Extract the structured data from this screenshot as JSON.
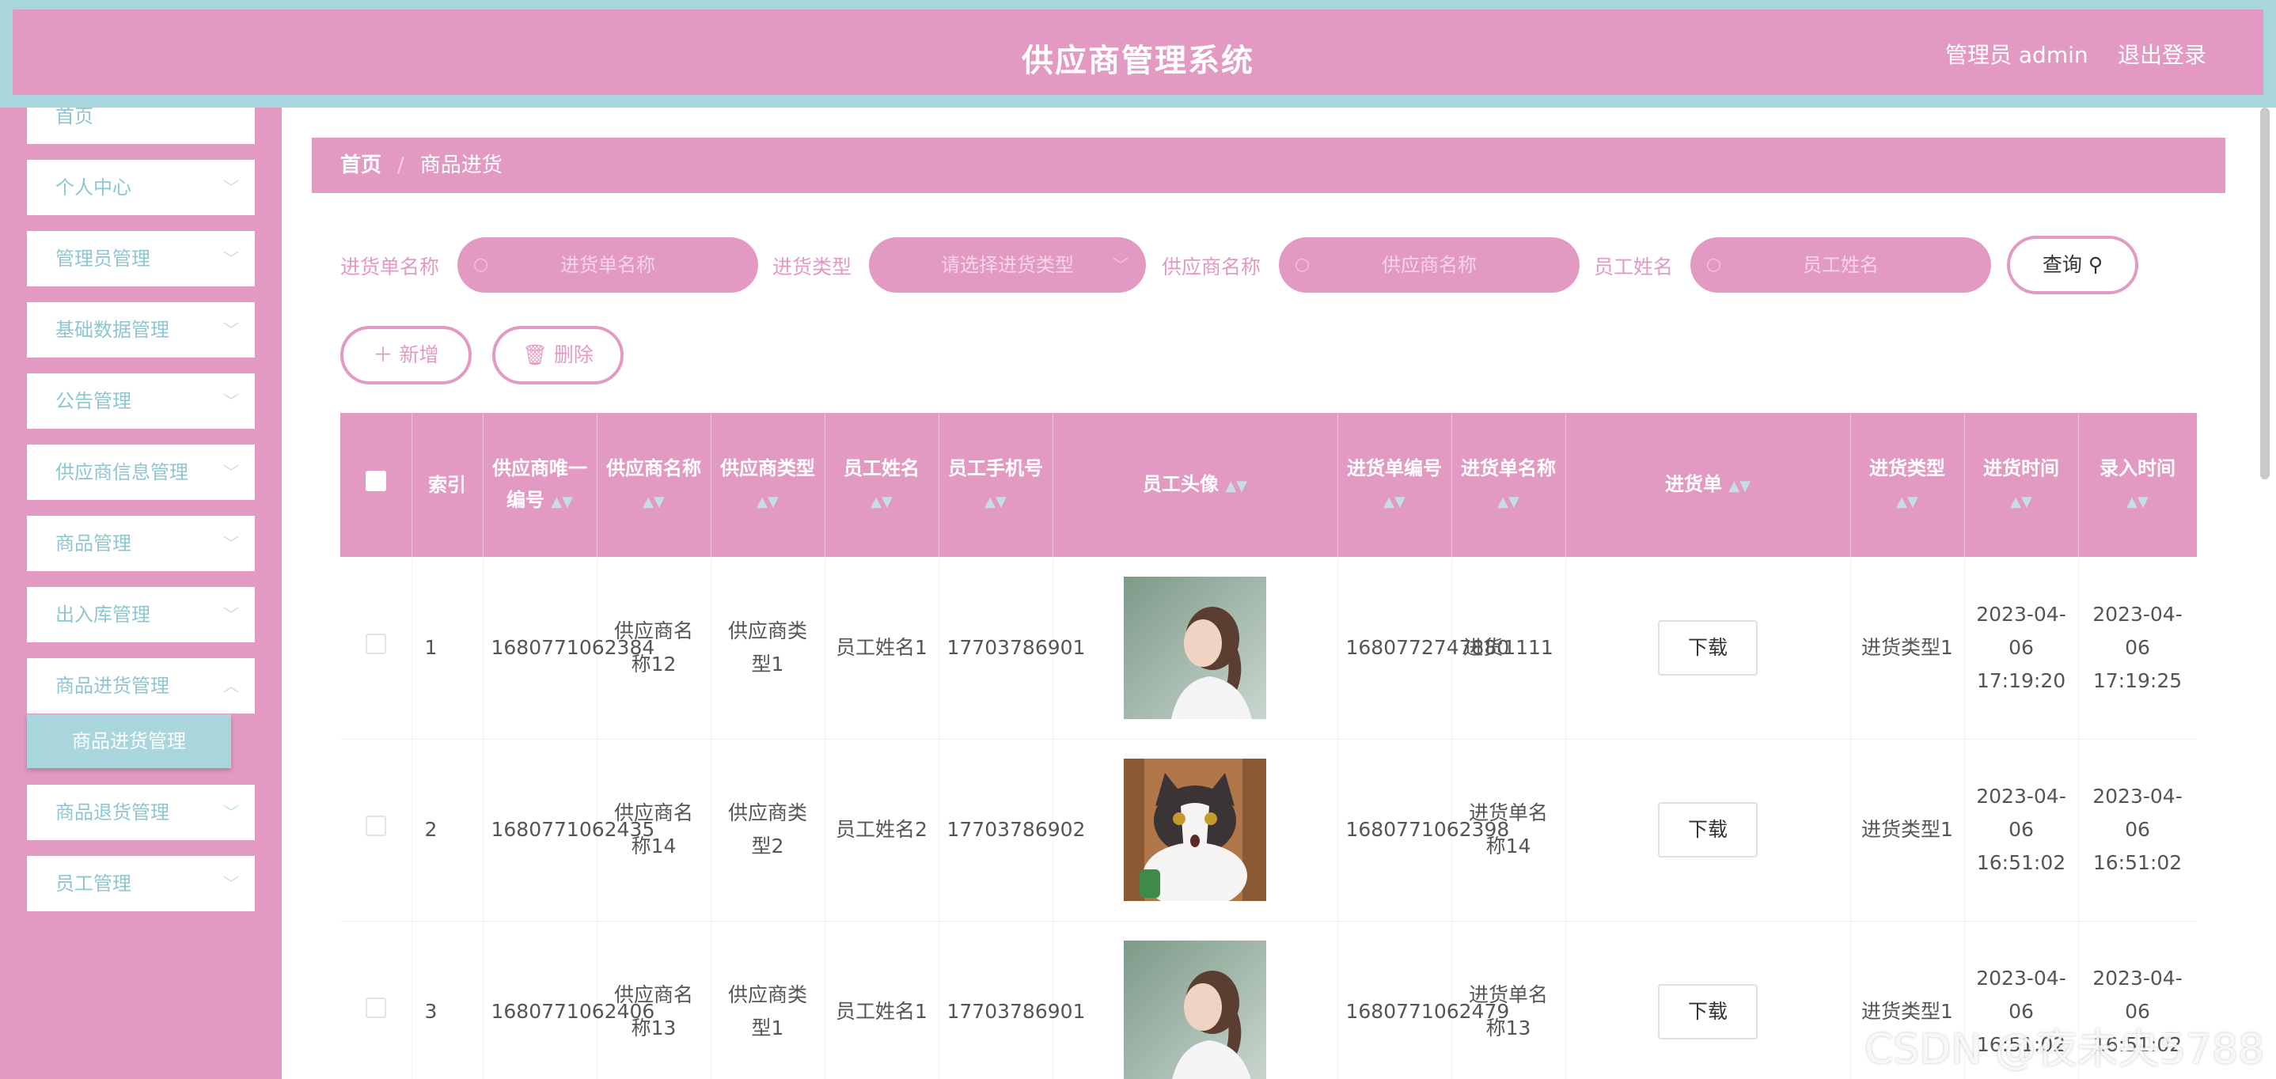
{
  "header": {
    "title": "供应商管理系统",
    "admin": "管理员 admin",
    "logout": "退出登录"
  },
  "sidebar": {
    "items": [
      {
        "label": "首页"
      },
      {
        "label": "个人中心"
      },
      {
        "label": "管理员管理"
      },
      {
        "label": "基础数据管理"
      },
      {
        "label": "公告管理"
      },
      {
        "label": "供应商信息管理"
      },
      {
        "label": "商品管理"
      },
      {
        "label": "出入库管理"
      },
      {
        "label": "商品进货管理"
      },
      {
        "label": "商品退货管理"
      },
      {
        "label": "员工管理"
      }
    ],
    "active_sub": "商品进货管理"
  },
  "breadcrumb": {
    "home": "首页",
    "separator": "/",
    "current": "商品进货"
  },
  "search": {
    "order_name_label": "进货单名称",
    "order_name_placeholder": "进货单名称",
    "type_label": "进货类型",
    "type_placeholder": "请选择进货类型",
    "supplier_label": "供应商名称",
    "supplier_placeholder": "供应商名称",
    "employee_label": "员工姓名",
    "employee_placeholder": "员工姓名",
    "query": "查询"
  },
  "actions": {
    "add": "新增",
    "delete": "删除"
  },
  "table": {
    "headers": {
      "index": "索引",
      "supplier_id": "供应商唯一编号",
      "supplier_name": "供应商名称",
      "supplier_type": "供应商类型",
      "employee_name": "员工姓名",
      "employee_phone": "员工手机号",
      "employee_avatar": "员工头像",
      "order_no": "进货单编号",
      "order_name": "进货单名称",
      "order_file": "进货单",
      "order_type": "进货类型",
      "order_time": "进货时间",
      "entry_time": "录入时间"
    },
    "download_label": "下载",
    "rows": [
      {
        "index": "1",
        "supplier_id": "1680771062384",
        "supplier_name": "供应商名称12",
        "supplier_type": "供应商类型1",
        "employee_name": "员工姓名1",
        "employee_phone": "17703786901",
        "avatar": "woman-portrait",
        "order_no": "1680772747880",
        "order_name": "进货1111",
        "order_type": "进货类型1",
        "order_time": "2023-04-06 17:19:20",
        "entry_time": "2023-04-06 17:19:25"
      },
      {
        "index": "2",
        "supplier_id": "1680771062435",
        "supplier_name": "供应商名称14",
        "supplier_type": "供应商类型2",
        "employee_name": "员工姓名2",
        "employee_phone": "17703786902",
        "avatar": "cat-portrait",
        "order_no": "1680771062398",
        "order_name": "进货单名称14",
        "order_type": "进货类型1",
        "order_time": "2023-04-06 16:51:02",
        "entry_time": "2023-04-06 16:51:02"
      },
      {
        "index": "3",
        "supplier_id": "1680771062406",
        "supplier_name": "供应商名称13",
        "supplier_type": "供应商类型1",
        "employee_name": "员工姓名1",
        "employee_phone": "17703786901",
        "avatar": "woman-portrait",
        "order_no": "1680771062479",
        "order_name": "进货单名称13",
        "order_type": "进货类型1",
        "order_time": "2023-04-06 16:51:02",
        "entry_time": "2023-04-06 16:51:02"
      }
    ]
  },
  "watermark": "CSDN @夜未央5788",
  "colors": {
    "primary_pink": "#e39ac2",
    "accent_teal": "#a9d6dc",
    "sidebar_text": "#8ec6cf"
  }
}
